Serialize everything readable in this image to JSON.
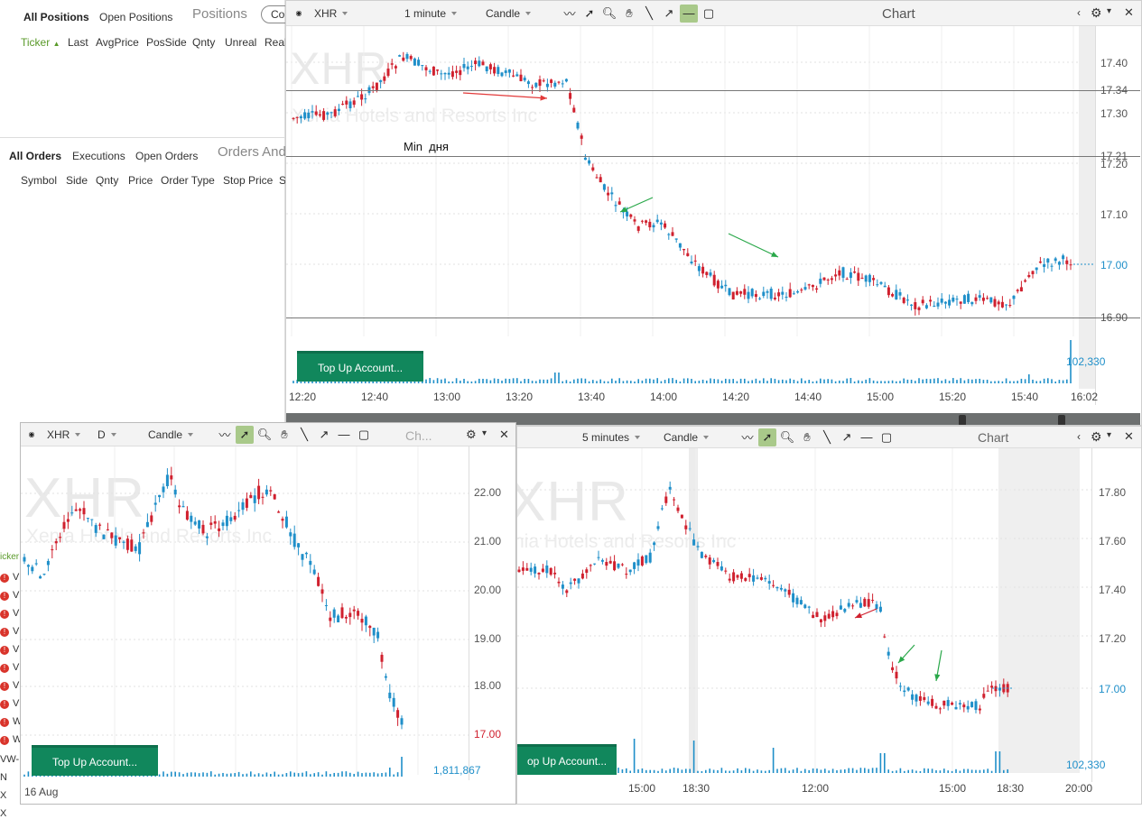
{
  "positions_panel": {
    "tabs": [
      "All Positions",
      "Open Positions"
    ],
    "title": "Positions",
    "button": "Co",
    "columns": [
      "Ticker",
      "Last",
      "AvgPrice",
      "PosSide",
      "Qnty",
      "Unreal",
      "Real"
    ]
  },
  "orders_panel": {
    "tabs": [
      "All Orders",
      "Executions",
      "Open Orders"
    ],
    "title": "Orders And",
    "columns": [
      "Symbol",
      "Side",
      "Qnty",
      "Price",
      "Order Type",
      "Stop Price",
      "S"
    ]
  },
  "bg_alerts": {
    "ticker_label": "icker",
    "rows": [
      "V",
      "V",
      "V",
      "V",
      "V",
      "V",
      "V",
      "V",
      "W",
      "W"
    ],
    "row_extra": [
      "VW-",
      "N",
      "X",
      "X"
    ]
  },
  "chart1": {
    "symbol": "XHR",
    "interval": "1 minute",
    "style": "Candle",
    "title": "Chart",
    "watermark_symbol": "XHR",
    "watermark_name": "Xenia Hotels and Resorts Inc",
    "annotation": "Min  дня",
    "price_labels": [
      "17.40",
      "17.34",
      "17.30",
      "17.21",
      "17.20",
      "17.10",
      "17.00",
      "16.90"
    ],
    "current_price": "17.00",
    "time_labels": [
      "12:20",
      "12:40",
      "13:00",
      "13:20",
      "13:40",
      "14:00",
      "14:20",
      "14:40",
      "15:00",
      "15:20",
      "15:40",
      "16:02"
    ],
    "volume_label": "102,330",
    "topup": "Top Up Account...",
    "colors": {
      "up": "#1f8fc9",
      "down": "#d0202e",
      "arrow_red": "#e23a3a",
      "arrow_green": "#2aa84a"
    }
  },
  "chart2": {
    "symbol": "XHR",
    "interval": "D",
    "style": "Candle",
    "title": "Ch...",
    "watermark_symbol": "XHR",
    "watermark_name": "Xenia Hotels and Resorts Inc",
    "price_labels": [
      "22.00",
      "21.00",
      "20.00",
      "19.00",
      "18.00",
      "17.00"
    ],
    "current_price": "17.00",
    "date_label": "16 Aug",
    "volume_label": "1,811,867",
    "topup": "Top Up Account..."
  },
  "chart3": {
    "interval": "5 minutes",
    "style": "Candle",
    "title": "Chart",
    "watermark_symbol": "XHR",
    "watermark_name": "nia Hotels and Resorts Inc",
    "price_labels": [
      "17.80",
      "17.60",
      "17.40",
      "17.20",
      "17.00"
    ],
    "current_price": "17.00",
    "time_labels": [
      "15:00",
      "18:30",
      "12:00",
      "15:00",
      "18:30",
      "20:00"
    ],
    "volume_label": "102,330",
    "topup": "op Up Account..."
  }
}
